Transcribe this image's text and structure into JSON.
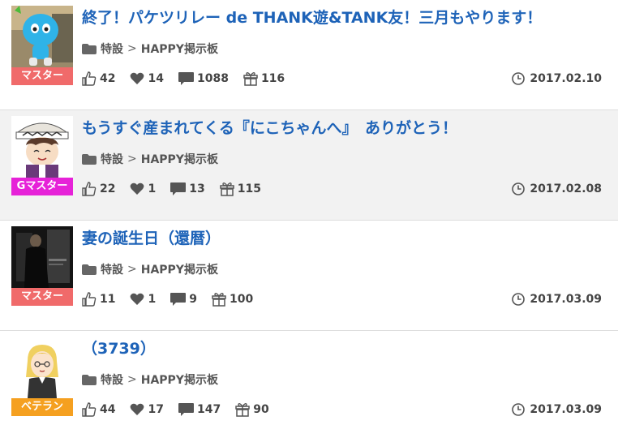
{
  "posts": [
    {
      "title": "終了！パケツリレー de THANK遊&TANK友！三月もやります！",
      "category": "特設",
      "board": "HAPPY掲示板",
      "rank": "マスター",
      "rank_color": "#f06a6a",
      "likes": "42",
      "hearts": "14",
      "comments": "1088",
      "gifts": "116",
      "date": "2017.02.10"
    },
    {
      "title": "もうすぐ産まれてくる『にこちゃんへ』　ありがとう！",
      "category": "特設",
      "board": "HAPPY掲示板",
      "rank": "Gマスター",
      "rank_color": "#e622d8",
      "likes": "22",
      "hearts": "1",
      "comments": "13",
      "gifts": "115",
      "date": "2017.02.08"
    },
    {
      "title": "妻の誕生日（還暦）",
      "category": "特設",
      "board": "HAPPY掲示板",
      "rank": "マスター",
      "rank_color": "#f06a6a",
      "likes": "11",
      "hearts": "1",
      "comments": "9",
      "gifts": "100",
      "date": "2017.03.09"
    },
    {
      "title": "（3739）",
      "category": "特設",
      "board": "HAPPY掲示板",
      "rank": "ベテラン",
      "rank_color": "#f5a020",
      "likes": "44",
      "hearts": "17",
      "comments": "147",
      "gifts": "90",
      "date": "2017.03.09"
    }
  ],
  "separator": ">"
}
